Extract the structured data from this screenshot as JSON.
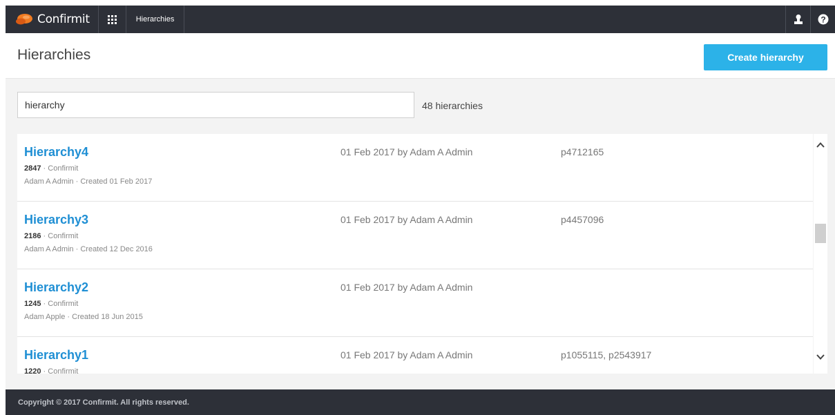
{
  "topbar": {
    "brand": "Confirmit",
    "breadcrumb": "Hierarchies",
    "icons": [
      "logo-icon",
      "apps-grid-icon",
      "user-icon",
      "help-icon"
    ]
  },
  "header": {
    "title": "Hierarchies",
    "create_label": "Create hierarchy"
  },
  "search": {
    "value": "hierarchy",
    "count_label": "48 hierarchies"
  },
  "rows": [
    {
      "name": "Hierarchy4",
      "id": "2847",
      "source": "Confirmit",
      "owner": "Adam A Admin",
      "created": "Created 01 Feb 2017",
      "modified": "01 Feb 2017 by Adam A Admin",
      "projects": "p4712165"
    },
    {
      "name": "Hierarchy3",
      "id": "2186",
      "source": "Confirmit",
      "owner": "Adam A Admin",
      "created": "Created 12 Dec 2016",
      "modified": "01 Feb 2017 by Adam A Admin",
      "projects": "p4457096"
    },
    {
      "name": "Hierarchy2",
      "id": "1245",
      "source": "Confirmit",
      "owner": "Adam Apple",
      "created": "Created 18 Jun 2015",
      "modified": "01 Feb 2017 by Adam A Admin",
      "projects": ""
    },
    {
      "name": "Hierarchy1",
      "id": "1220",
      "source": "Confirmit",
      "owner": "",
      "created": "",
      "modified": "01 Feb 2017 by Adam A Admin",
      "projects": "p1055115, p2543917"
    }
  ],
  "separator": "·",
  "footer": {
    "text": "Copyright © 2017 Confirmit. All rights reserved."
  },
  "colors": {
    "topbar": "#2d3038",
    "accent": "#2cb2e8",
    "link": "#1f8fd4",
    "content_bg": "#f3f3f3",
    "logo_orange": "#f07c22"
  }
}
